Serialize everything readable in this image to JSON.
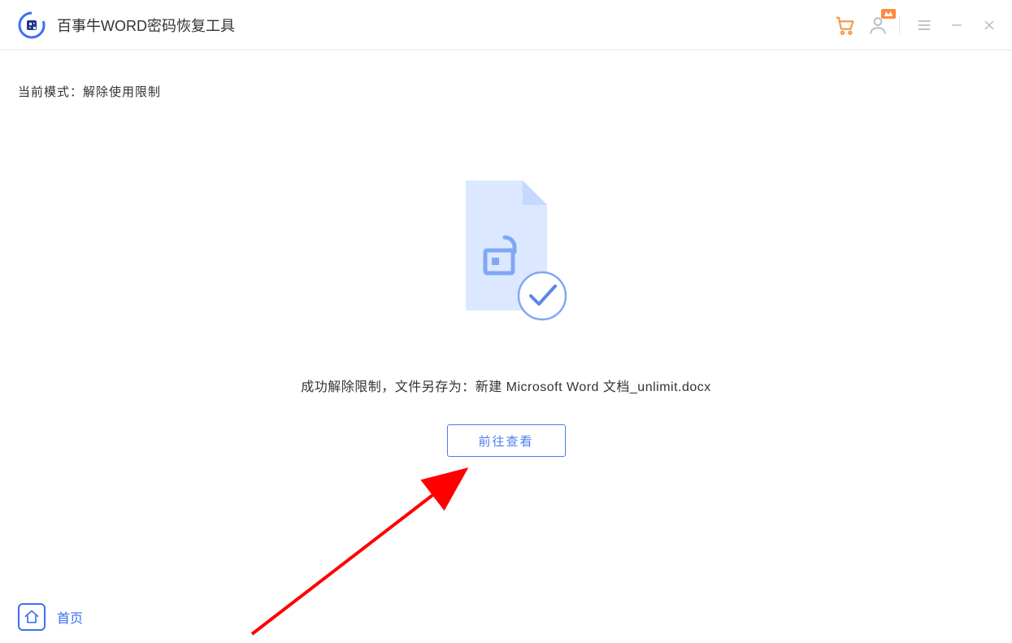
{
  "titlebar": {
    "app_title": "百事牛WORD密码恢复工具"
  },
  "content": {
    "mode_label": "当前模式：",
    "mode_value": "解除使用限制",
    "success_prefix": "成功解除限制，文件另存为：",
    "saved_filename": "新建 Microsoft Word 文档_unlimit.docx",
    "go_view_label": "前往查看"
  },
  "footer": {
    "home_label": "首页"
  },
  "colors": {
    "accent": "#3d6ff5",
    "arrow": "#ff0000"
  },
  "icons": {
    "cart": "cart-icon",
    "user": "user-icon",
    "menu": "menu-icon",
    "minimize": "minimize-icon",
    "close": "close-icon",
    "home": "home-icon",
    "logo": "app-logo-icon",
    "doc_unlocked": "document-unlocked-icon",
    "check": "checkmark-icon"
  }
}
